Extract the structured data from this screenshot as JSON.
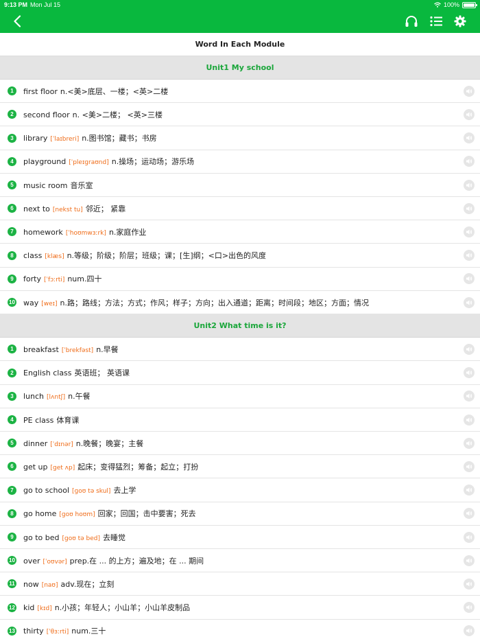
{
  "status_bar": {
    "time": "9:13 PM",
    "date": "Mon Jul 15",
    "battery": "100%",
    "battery_level": 1.0
  },
  "nav": {
    "back_icon": "chevron-left-icon",
    "actions": [
      "headphones-icon",
      "list-icon",
      "gear-icon"
    ]
  },
  "page_title": "Word In Each Module",
  "colors": {
    "brand_green": "#09b83e",
    "unit_title": "#1aa63a",
    "phonetic": "#ef6b17",
    "number_badge": "#1cb344"
  },
  "units": [
    {
      "title": "Unit1  My school",
      "words": [
        {
          "n": "1",
          "word": "first floor",
          "phon": "",
          "mean": "n.<美>底层、一楼；<英>二楼"
        },
        {
          "n": "2",
          "word": "second floor",
          "phon": "",
          "mean": "n. <美>二楼；  <英>三楼"
        },
        {
          "n": "3",
          "word": "library",
          "phon": "[ˈlaɪbreri]",
          "mean": "n.图书馆；藏书；书房"
        },
        {
          "n": "4",
          "word": "playground",
          "phon": "[ˈpleɪɡraʊnd]",
          "mean": "n.操场；运动场；游乐场"
        },
        {
          "n": "5",
          "word": "music room",
          "phon": "",
          "mean": "音乐室"
        },
        {
          "n": "6",
          "word": "next to",
          "phon": "[nekst tu]",
          "mean": "邻近；  紧靠"
        },
        {
          "n": "7",
          "word": "homework",
          "phon": "[ˈhoʊmwɜːrk]",
          "mean": "n.家庭作业"
        },
        {
          "n": "8",
          "word": "class",
          "phon": "[klæs]",
          "mean": "n.等级；阶级；阶层；班级；课；[生]纲；<口>出色的风度"
        },
        {
          "n": "9",
          "word": "forty",
          "phon": "[ˈfɔːrti]",
          "mean": "num.四十"
        },
        {
          "n": "10",
          "word": "way",
          "phon": "[weɪ]",
          "mean": "n.路；路线；方法；方式；作风；样子；方向；出入通道；距离；时间段；地区；方面；情况"
        }
      ]
    },
    {
      "title": "Unit2  What time is it?",
      "words": [
        {
          "n": "1",
          "word": "breakfast",
          "phon": "[ˈbrekfəst]",
          "mean": "n.早餐"
        },
        {
          "n": "2",
          "word": "English class",
          "phon": "",
          "mean": "英语班；  英语课"
        },
        {
          "n": "3",
          "word": "lunch",
          "phon": "[lʌntʃ]",
          "mean": "n.午餐"
        },
        {
          "n": "4",
          "word": "PE class",
          "phon": "",
          "mean": "体育课"
        },
        {
          "n": "5",
          "word": "dinner",
          "phon": "[ˈdɪnər]",
          "mean": "n.晚餐；晚宴；主餐"
        },
        {
          "n": "6",
          "word": "get up",
          "phon": "[ɡet ʌp]",
          "mean": "起床；变得猛烈；筹备；起立；打扮"
        },
        {
          "n": "7",
          "word": "go to school",
          "phon": "[ɡoʊ tə skul]",
          "mean": "去上学"
        },
        {
          "n": "8",
          "word": "go home",
          "phon": "[ɡoʊ hoʊm]",
          "mean": "回家；回国；击中要害；死去"
        },
        {
          "n": "9",
          "word": "go to bed",
          "phon": "[ɡoʊ tə bed]",
          "mean": "去睡觉"
        },
        {
          "n": "10",
          "word": "over",
          "phon": "[ˈoʊvər]",
          "mean": "prep.在 ... 的上方；遍及地；在 ... 期间"
        },
        {
          "n": "11",
          "word": "now",
          "phon": "[naʊ]",
          "mean": "adv.现在；立刻"
        },
        {
          "n": "12",
          "word": "kid",
          "phon": "[kɪd]",
          "mean": "n.小孩；年轻人；小山羊；小山羊皮制品"
        },
        {
          "n": "13",
          "word": "thirty",
          "phon": "[ˈθɜːrti]",
          "mean": "num.三十"
        }
      ]
    }
  ]
}
